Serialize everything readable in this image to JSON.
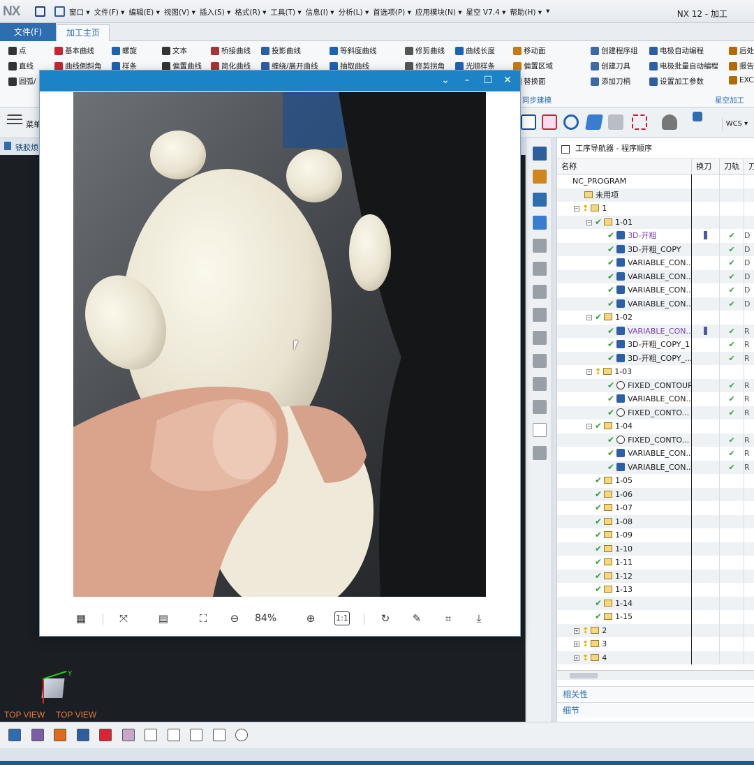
{
  "app": {
    "logo": "NX",
    "title": "NX 12 - 加工"
  },
  "menu": [
    "窗口 ▾",
    "文件(F) ▾",
    "编辑(E) ▾",
    "视图(V) ▾",
    "插入(S) ▾",
    "格式(R) ▾",
    "工具(T) ▾",
    "信息(I) ▾",
    "分析(L) ▾",
    "首选项(P) ▾",
    "应用模块(N) ▾",
    "星空 V7.4 ▾",
    "帮助(H) ▾",
    "▾"
  ],
  "tabs": {
    "file": "文件(F)",
    "home": "加工主页"
  },
  "ribbon": {
    "col1": [
      "点",
      "直线",
      "圆弧/"
    ],
    "col2": [
      "基本曲线",
      "曲线倒斜角",
      ""
    ],
    "col3": [
      "螺旋",
      "样条",
      ""
    ],
    "col4": [
      "文本",
      "偏置曲线",
      ""
    ],
    "col5": [
      "桥接曲线",
      "简化曲线",
      ""
    ],
    "col6": [
      "投影曲线",
      "缠绕/展开曲线",
      ""
    ],
    "col7": [
      "等斜度曲线",
      "抽取曲线",
      ""
    ],
    "col8": [
      "修剪曲线",
      "修剪拐角",
      ""
    ],
    "col9": [
      "曲线长度",
      "光顺样条",
      ""
    ],
    "col10": [
      "移动面",
      "偏置区域",
      "替换面"
    ],
    "col11": [
      "创建程序组",
      "创建刀具",
      "添加刀柄"
    ],
    "col12": [
      "电极自动编程",
      "电极批量自动编程",
      "设置加工参数"
    ],
    "col13": [
      "后处",
      "报告",
      "EXC"
    ],
    "groups": {
      "sync": "同步建模",
      "xk": "星空加工"
    }
  },
  "toolbar2": {
    "menu_label": "菜单",
    "wcs": "WCS ▾"
  },
  "breadcrumb": "铁胶烦",
  "graphics": {
    "view_label_1": "TOP VIEW",
    "view_label_2": "TOP VIEW",
    "axis_y": "Y",
    "axis_x": "X"
  },
  "navigator": {
    "title": "工序导航器 - 程序顺序",
    "columns": [
      "名称",
      "换刀",
      "刀轨",
      "刀"
    ],
    "rows": [
      {
        "name": "NC_PROGRAM",
        "indent": 0,
        "type": "root"
      },
      {
        "name": "未用项",
        "indent": 1,
        "type": "folder"
      },
      {
        "name": "1",
        "indent": 1,
        "type": "group",
        "bulb": true,
        "expand": "−"
      },
      {
        "name": "1-01",
        "indent": 2,
        "type": "group",
        "check": true,
        "expand": "−"
      },
      {
        "name": "3D-开粗",
        "indent": 3,
        "type": "op",
        "purple": true,
        "tool": true,
        "path": "✔",
        "x": "D"
      },
      {
        "name": "3D-开粗_COPY",
        "indent": 3,
        "type": "op",
        "path": "✔",
        "x": "D"
      },
      {
        "name": "VARIABLE_CON...",
        "indent": 3,
        "type": "op",
        "path": "✔",
        "x": "D"
      },
      {
        "name": "VARIABLE_CON...",
        "indent": 3,
        "type": "op",
        "path": "✔",
        "x": "D"
      },
      {
        "name": "VARIABLE_CON...",
        "indent": 3,
        "type": "op",
        "path": "✔",
        "x": "D"
      },
      {
        "name": "VARIABLE_CON...",
        "indent": 3,
        "type": "op",
        "path": "✔",
        "x": "D"
      },
      {
        "name": "1-02",
        "indent": 2,
        "type": "group",
        "check": true,
        "expand": "−"
      },
      {
        "name": "VARIABLE_CON...",
        "indent": 3,
        "type": "op",
        "purple": true,
        "tool": true,
        "path": "✔",
        "x": "R"
      },
      {
        "name": "3D-开粗_COPY_1",
        "indent": 3,
        "type": "op",
        "path": "✔",
        "x": "R"
      },
      {
        "name": "3D-开粗_COPY_...",
        "indent": 3,
        "type": "op",
        "path": "✔",
        "x": "R"
      },
      {
        "name": "1-03",
        "indent": 2,
        "type": "group",
        "bulb": true,
        "expand": "−"
      },
      {
        "name": "FIXED_CONTOUR",
        "indent": 3,
        "type": "op",
        "fixed": true,
        "path": "✔",
        "x": "R"
      },
      {
        "name": "VARIABLE_CON...",
        "indent": 3,
        "type": "op",
        "path": "✔",
        "x": "R"
      },
      {
        "name": "FIXED_CONTO...",
        "indent": 3,
        "type": "op",
        "fixed": true,
        "path": "✔",
        "x": "R"
      },
      {
        "name": "1-04",
        "indent": 2,
        "type": "group",
        "check": true,
        "expand": "−"
      },
      {
        "name": "FIXED_CONTO...",
        "indent": 3,
        "type": "op",
        "fixed": true,
        "path": "✔",
        "x": "R"
      },
      {
        "name": "VARIABLE_CON...",
        "indent": 3,
        "type": "op",
        "path": "✔",
        "x": "R"
      },
      {
        "name": "VARIABLE_CON...",
        "indent": 3,
        "type": "op",
        "path": "✔",
        "x": "R"
      },
      {
        "name": "1-05",
        "indent": 2,
        "type": "group",
        "check": true
      },
      {
        "name": "1-06",
        "indent": 2,
        "type": "group",
        "check": true
      },
      {
        "name": "1-07",
        "indent": 2,
        "type": "group",
        "check": true
      },
      {
        "name": "1-08",
        "indent": 2,
        "type": "group",
        "check": true
      },
      {
        "name": "1-09",
        "indent": 2,
        "type": "group",
        "check": true
      },
      {
        "name": "1-10",
        "indent": 2,
        "type": "group",
        "check": true
      },
      {
        "name": "1-11",
        "indent": 2,
        "type": "group",
        "check": true
      },
      {
        "name": "1-12",
        "indent": 2,
        "type": "group",
        "check": true
      },
      {
        "name": "1-13",
        "indent": 2,
        "type": "group",
        "check": true
      },
      {
        "name": "1-14",
        "indent": 2,
        "type": "group",
        "check": true
      },
      {
        "name": "1-15",
        "indent": 2,
        "type": "group",
        "check": true
      },
      {
        "name": "2",
        "indent": 1,
        "type": "group",
        "bulb": true,
        "expand": "+"
      },
      {
        "name": "3",
        "indent": 1,
        "type": "group",
        "bulb": true,
        "expand": "+"
      },
      {
        "name": "4",
        "indent": 1,
        "type": "group",
        "bulb": true,
        "expand": "+"
      }
    ],
    "sections": [
      "相关性",
      "细节"
    ]
  },
  "viewer": {
    "zoom": "84%",
    "actual_size": "1:1"
  }
}
